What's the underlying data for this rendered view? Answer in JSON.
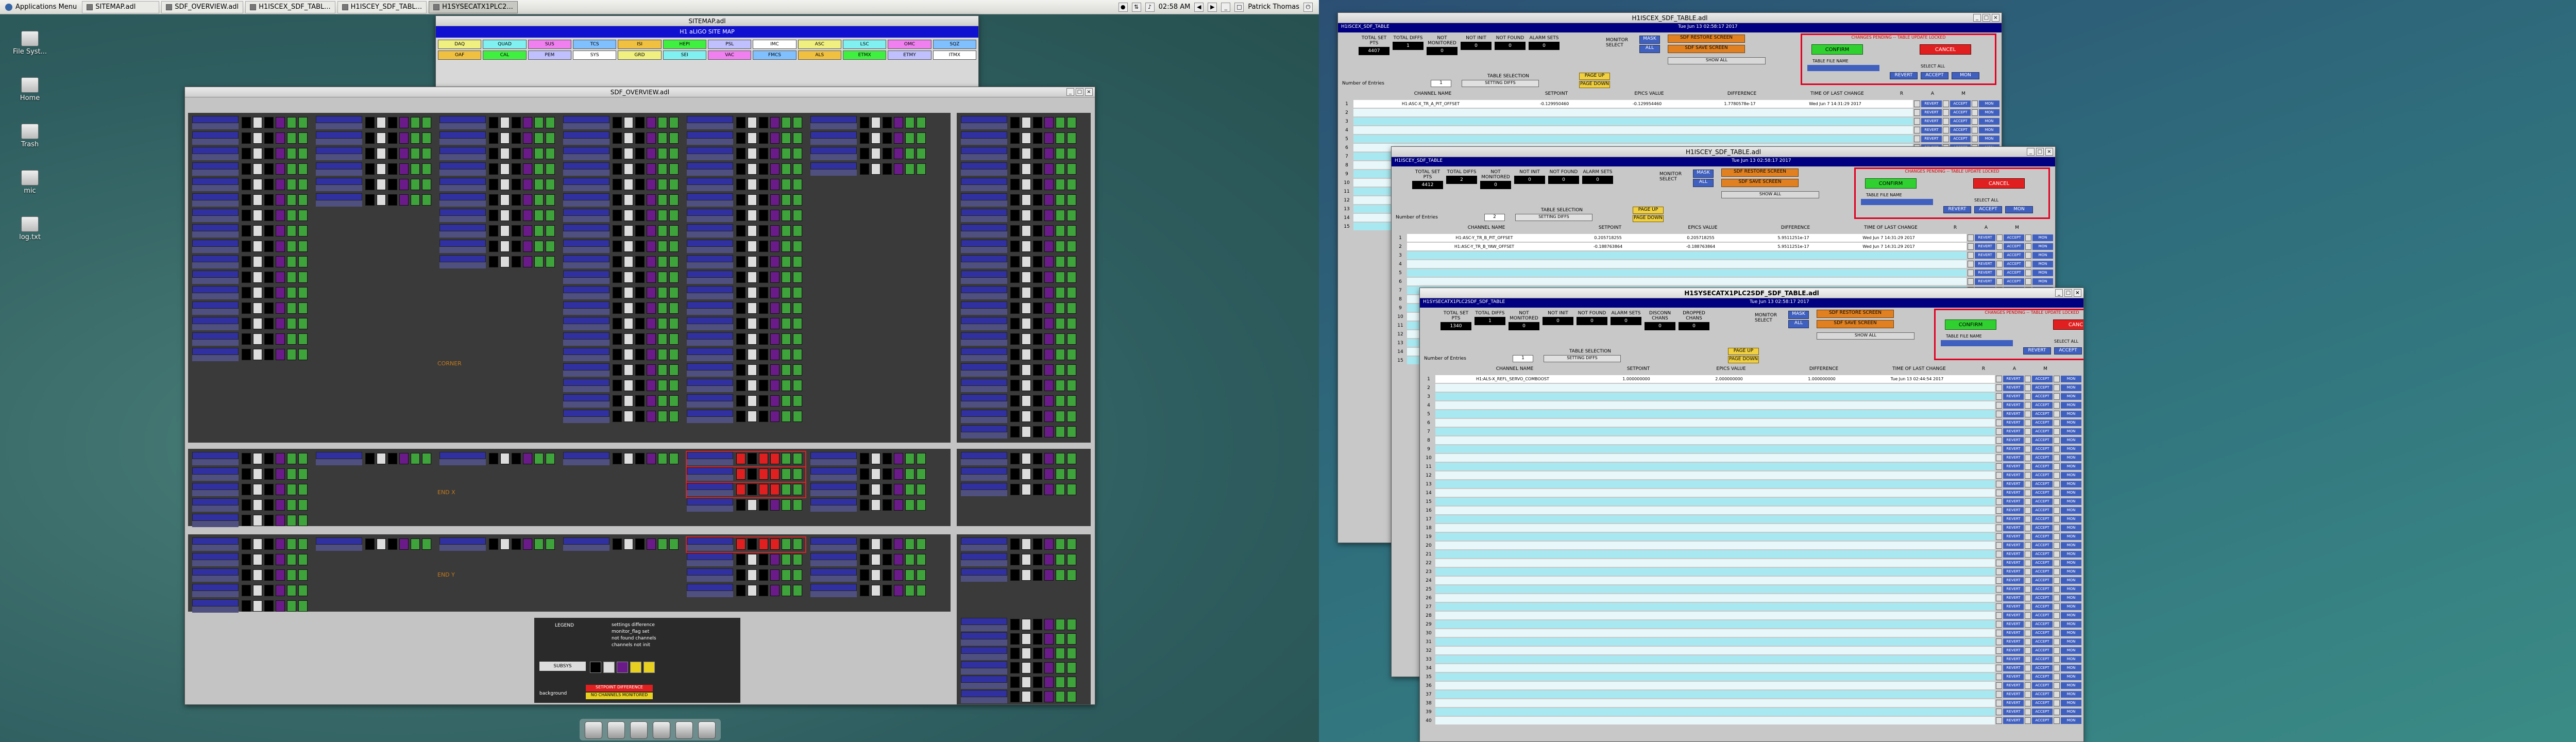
{
  "panel": {
    "apps_menu": "Applications Menu",
    "tasks": [
      "SITEMAP.adl",
      "SDF_OVERVIEW.adl",
      "H1ISCEX_SDF_TABL...",
      "H1ISCEY_SDF_TABL...",
      "H1SYSECATX1PLC2..."
    ],
    "clock": "02:58 AM",
    "user": "Patrick Thomas"
  },
  "desktop_icons": [
    "File Syst...",
    "Home",
    "Trash",
    "mic",
    "log.txt"
  ],
  "sitemap": {
    "title": "SITEMAP.adl",
    "header": "H1 aLIGO SITE MAP",
    "cells": [
      "DAQ",
      "QUAD",
      "SUS",
      "TCS",
      "ISI",
      "HEPI",
      "PSL",
      "IMC",
      "ASC",
      "LSC",
      "OMC",
      "SQZ",
      "OAF",
      "CAL",
      "PEM",
      "SYS",
      "GRD",
      "SEI",
      "VAC",
      "FMCS",
      "ALS",
      "ETMX",
      "ETMY",
      "ITMX"
    ]
  },
  "overview": {
    "title": "SDF_OVERVIEW.adl",
    "section_labels": [
      "CORNER",
      "END X",
      "END Y"
    ],
    "legend": {
      "title": "LEGEND",
      "unit": "SUBSYS",
      "notes": [
        "settings difference",
        "monitor_flag set",
        "not found channels",
        "channels not init"
      ],
      "background": "background",
      "warn1": "SETPOINT DIFFERENCE",
      "warn2": "NO CHANNELS MONITORED"
    }
  },
  "table1": {
    "title": "H1ISCEX_SDF_TABLE.adl",
    "window_name": "H1ISCEX_SDF_TABLE",
    "date": "Tue Jun 13 02:58:17 2017",
    "stats": [
      {
        "label": "TOTAL SET PTS",
        "value": "4407"
      },
      {
        "label": "TOTAL DIFFS",
        "value": "1"
      },
      {
        "label": "NOT MONITORED",
        "value": "0"
      },
      {
        "label": "NOT INIT",
        "value": "0"
      },
      {
        "label": "NOT FOUND",
        "value": "0"
      },
      {
        "label": "ALARM SETS",
        "value": "0"
      }
    ],
    "monitor_select": "MONITOR SELECT",
    "mask": "MASK",
    "all": "ALL",
    "sdf_restore": "SDF RESTORE SCREEN",
    "sdf_save": "SDF SAVE SCREEN",
    "show_all": "SHOW ALL",
    "pending": "CHANGES PENDING -- TABLE UPDATE LOCKED",
    "confirm": "CONFIRM",
    "cancel": "CANCEL",
    "file_name": "TABLE FILE NAME",
    "select_all": "SELECT ALL",
    "revert": "REVERT",
    "accept": "ACCEPT",
    "mon": "MON",
    "entries_label": "Number of Entries",
    "entries": "1",
    "table_selection": "TABLE SELECTION",
    "setting_diffs": "SETTING DIFFS",
    "page_up": "PAGE UP",
    "page_down": "PAGE DOWN",
    "columns": [
      "CHANNEL NAME",
      "SETPOINT",
      "EPICS VALUE",
      "DIFFERENCE",
      "TIME OF LAST CHANGE",
      "R",
      "A",
      "M"
    ],
    "row": [
      "H1:ASC-X_TR_A_PIT_OFFSET",
      "-0.129950460",
      "-0.129954460",
      "1.7780578e-17",
      "Wed Jun 7 14:31:29 2017"
    ]
  },
  "table2": {
    "title": "H1ISCEY_SDF_TABLE.adl",
    "window_name": "H1ISCEY_SDF_TABLE",
    "date": "Tue Jun 13 02:58:17 2017",
    "stats": [
      {
        "label": "TOTAL SET PTS",
        "value": "4412"
      },
      {
        "label": "TOTAL DIFFS",
        "value": "2"
      },
      {
        "label": "NOT MONITORED",
        "value": "0"
      },
      {
        "label": "NOT INIT",
        "value": "0"
      },
      {
        "label": "NOT FOUND",
        "value": "0"
      },
      {
        "label": "ALARM SETS",
        "value": "0"
      }
    ],
    "entries": "2",
    "rows": [
      [
        "H1:ASC-Y_TR_B_PIT_OFFSET",
        "0.205718255",
        "0.205718255",
        "5.9511251e-17",
        "Wed Jun 7 14:31:29 2017"
      ],
      [
        "H1:ASC-Y_TR_B_YAW_OFFSET",
        "-0.188763864",
        "-0.188763864",
        "5.9511251e-17",
        "Wed Jun 7 14:31:29 2017"
      ]
    ]
  },
  "table3": {
    "title": "H1SYSECATX1PLC2SDF_SDF_TABLE.adl",
    "window_name": "H1SYSECATX1PLC2SDF_SDF_TABLE",
    "date": "Tue Jun 13 02:58:17 2017",
    "stats": [
      {
        "label": "TOTAL SET PTS",
        "value": "1340"
      },
      {
        "label": "TOTAL DIFFS",
        "value": "1"
      },
      {
        "label": "NOT MONITORED",
        "value": "0"
      },
      {
        "label": "NOT INIT",
        "value": "0"
      },
      {
        "label": "NOT FOUND",
        "value": "0"
      },
      {
        "label": "ALARM SETS",
        "value": "0"
      },
      {
        "label": "DISCONN CHANS",
        "value": "0"
      },
      {
        "label": "DROPPED CHANS",
        "value": "0"
      }
    ],
    "entries": "1",
    "row": [
      "H1:ALS-X_REFL_SERVO_COMBOOST",
      "1.000000000",
      "2.000000000",
      "1.000000000",
      "Tue Jun 13 02:44:54 2017"
    ]
  },
  "colors": {
    "accent_blue": "#000080",
    "pending_red": "#e00020",
    "confirm_green": "#30d030",
    "row_cyan": "#a8e8f0"
  }
}
